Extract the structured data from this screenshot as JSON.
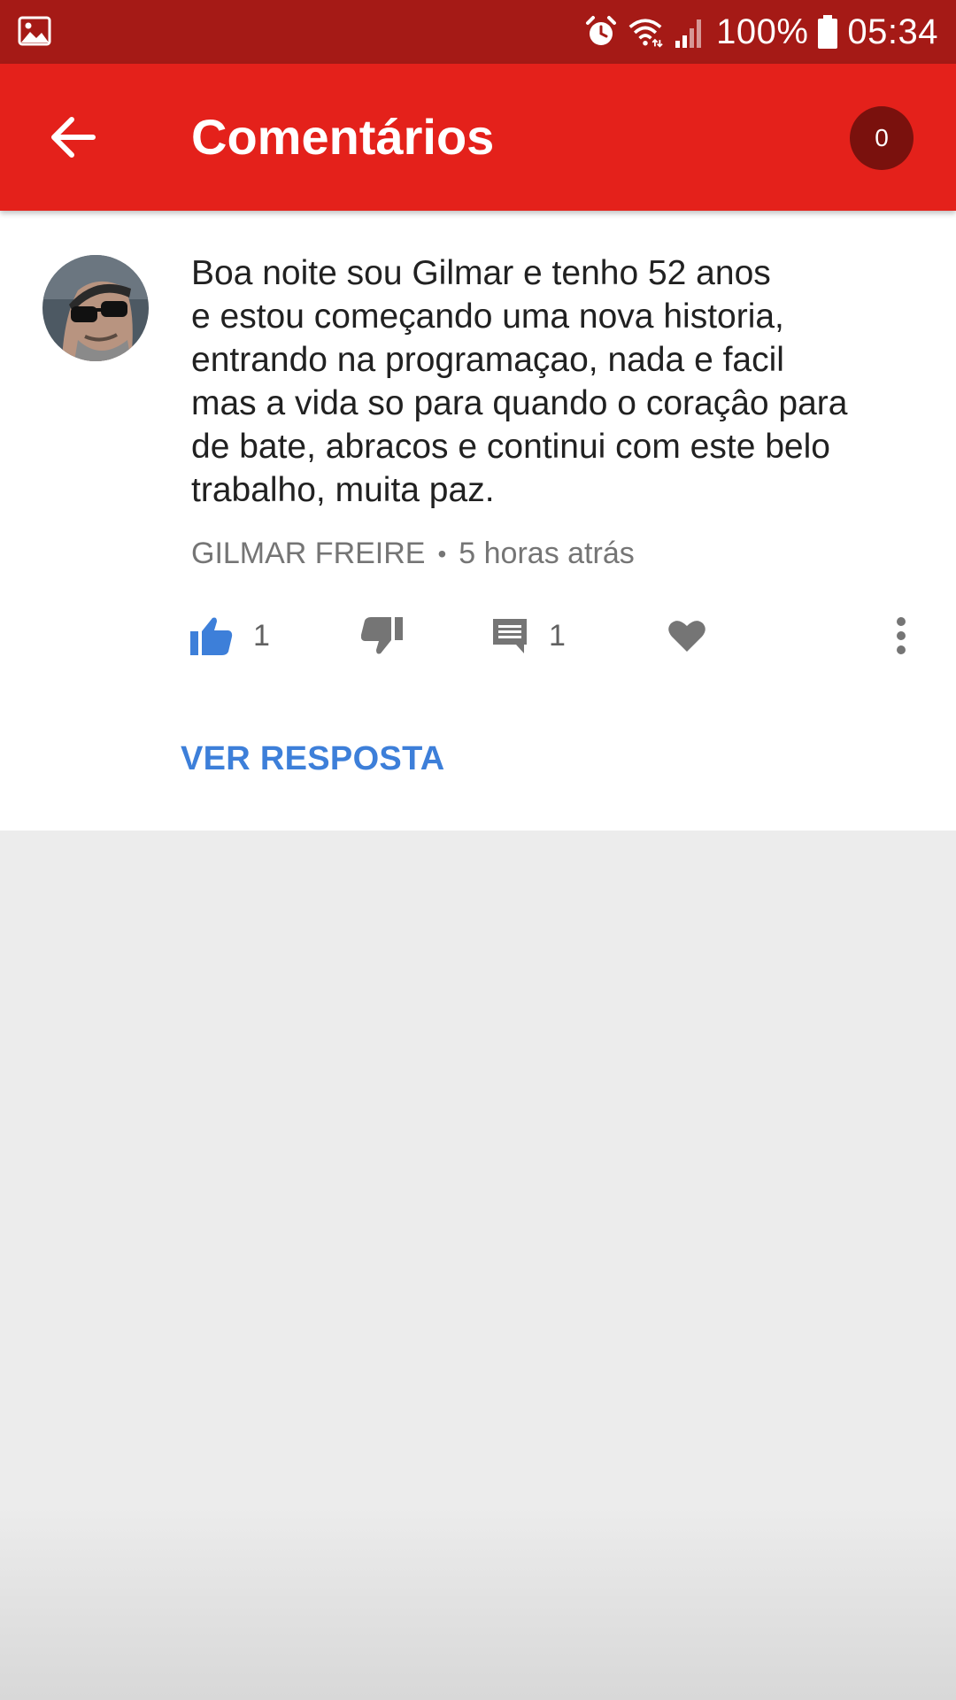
{
  "status_bar": {
    "battery": "100%",
    "time": "05:34",
    "icons": [
      "image-icon",
      "alarm-icon",
      "wifi-icon",
      "signal-icon",
      "battery-icon"
    ]
  },
  "app_bar": {
    "title": "Comentários",
    "badge_count": "0",
    "background": "#e4211b"
  },
  "comment": {
    "text_lines": [
      "Boa noite sou Gilmar e tenho 52 anos",
      "e estou começando uma nova historia,",
      "entrando na programaçao, nada e facil",
      "mas a vida so para quando o coraçâo para",
      "de bate, abracos e continui com este belo",
      "trabalho, muita paz."
    ],
    "author": "GILMAR FREIRE",
    "separator": "•",
    "time_ago": "5 horas atrás",
    "likes": "1",
    "replies": "1",
    "view_replies_label": "VER RESPOSTA"
  },
  "colors": {
    "status_bar": "#a51a16",
    "accent_blue": "#3d7fd9",
    "badge": "#7a110d"
  }
}
